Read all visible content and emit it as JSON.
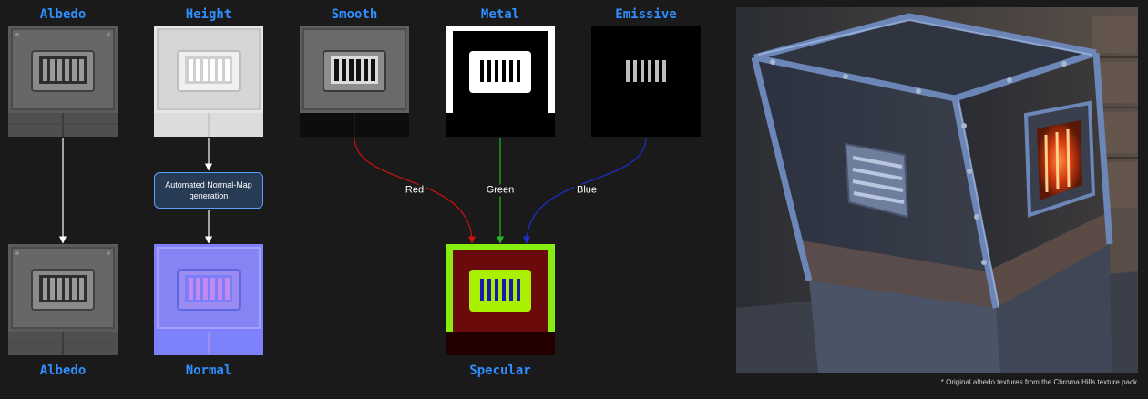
{
  "labels": {
    "albedo_top": "Albedo",
    "height": "Height",
    "smooth": "Smooth",
    "metal": "Metal",
    "emissive": "Emissive",
    "albedo_bottom": "Albedo",
    "normal": "Normal",
    "specular": "Specular"
  },
  "process": {
    "normal_generation": "Automated Normal-Map generation"
  },
  "channels": {
    "red": "Red",
    "green": "Green",
    "blue": "Blue"
  },
  "colors": {
    "label_blue": "#2f8fff",
    "arrow_white": "#ffffff",
    "arrow_red": "#cc1111",
    "arrow_green": "#22bb22",
    "arrow_blue": "#1a2fd0",
    "box_border": "#5aa0ff",
    "background": "#1a1a1a"
  },
  "footnote": "* Original albedo textures from the Chroma Hills texture pack"
}
